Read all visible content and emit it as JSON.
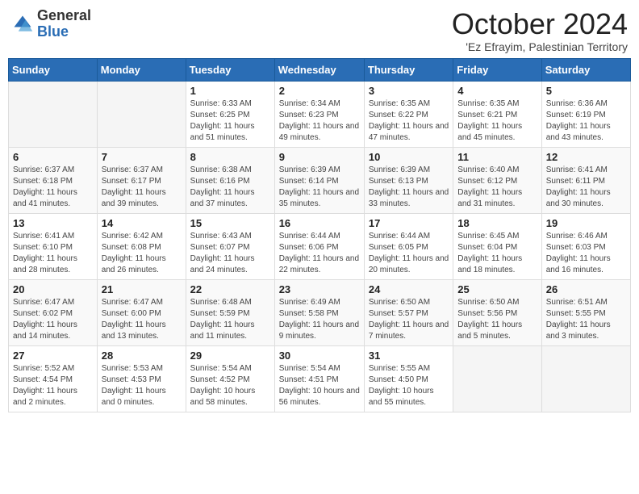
{
  "logo": {
    "general": "General",
    "blue": "Blue"
  },
  "title": "October 2024",
  "subtitle": "'Ez Efrayim, Palestinian Territory",
  "days_of_week": [
    "Sunday",
    "Monday",
    "Tuesday",
    "Wednesday",
    "Thursday",
    "Friday",
    "Saturday"
  ],
  "weeks": [
    [
      {
        "day": "",
        "info": ""
      },
      {
        "day": "",
        "info": ""
      },
      {
        "day": "1",
        "info": "Sunrise: 6:33 AM\nSunset: 6:25 PM\nDaylight: 11 hours and 51 minutes."
      },
      {
        "day": "2",
        "info": "Sunrise: 6:34 AM\nSunset: 6:23 PM\nDaylight: 11 hours and 49 minutes."
      },
      {
        "day": "3",
        "info": "Sunrise: 6:35 AM\nSunset: 6:22 PM\nDaylight: 11 hours and 47 minutes."
      },
      {
        "day": "4",
        "info": "Sunrise: 6:35 AM\nSunset: 6:21 PM\nDaylight: 11 hours and 45 minutes."
      },
      {
        "day": "5",
        "info": "Sunrise: 6:36 AM\nSunset: 6:19 PM\nDaylight: 11 hours and 43 minutes."
      }
    ],
    [
      {
        "day": "6",
        "info": "Sunrise: 6:37 AM\nSunset: 6:18 PM\nDaylight: 11 hours and 41 minutes."
      },
      {
        "day": "7",
        "info": "Sunrise: 6:37 AM\nSunset: 6:17 PM\nDaylight: 11 hours and 39 minutes."
      },
      {
        "day": "8",
        "info": "Sunrise: 6:38 AM\nSunset: 6:16 PM\nDaylight: 11 hours and 37 minutes."
      },
      {
        "day": "9",
        "info": "Sunrise: 6:39 AM\nSunset: 6:14 PM\nDaylight: 11 hours and 35 minutes."
      },
      {
        "day": "10",
        "info": "Sunrise: 6:39 AM\nSunset: 6:13 PM\nDaylight: 11 hours and 33 minutes."
      },
      {
        "day": "11",
        "info": "Sunrise: 6:40 AM\nSunset: 6:12 PM\nDaylight: 11 hours and 31 minutes."
      },
      {
        "day": "12",
        "info": "Sunrise: 6:41 AM\nSunset: 6:11 PM\nDaylight: 11 hours and 30 minutes."
      }
    ],
    [
      {
        "day": "13",
        "info": "Sunrise: 6:41 AM\nSunset: 6:10 PM\nDaylight: 11 hours and 28 minutes."
      },
      {
        "day": "14",
        "info": "Sunrise: 6:42 AM\nSunset: 6:08 PM\nDaylight: 11 hours and 26 minutes."
      },
      {
        "day": "15",
        "info": "Sunrise: 6:43 AM\nSunset: 6:07 PM\nDaylight: 11 hours and 24 minutes."
      },
      {
        "day": "16",
        "info": "Sunrise: 6:44 AM\nSunset: 6:06 PM\nDaylight: 11 hours and 22 minutes."
      },
      {
        "day": "17",
        "info": "Sunrise: 6:44 AM\nSunset: 6:05 PM\nDaylight: 11 hours and 20 minutes."
      },
      {
        "day": "18",
        "info": "Sunrise: 6:45 AM\nSunset: 6:04 PM\nDaylight: 11 hours and 18 minutes."
      },
      {
        "day": "19",
        "info": "Sunrise: 6:46 AM\nSunset: 6:03 PM\nDaylight: 11 hours and 16 minutes."
      }
    ],
    [
      {
        "day": "20",
        "info": "Sunrise: 6:47 AM\nSunset: 6:02 PM\nDaylight: 11 hours and 14 minutes."
      },
      {
        "day": "21",
        "info": "Sunrise: 6:47 AM\nSunset: 6:00 PM\nDaylight: 11 hours and 13 minutes."
      },
      {
        "day": "22",
        "info": "Sunrise: 6:48 AM\nSunset: 5:59 PM\nDaylight: 11 hours and 11 minutes."
      },
      {
        "day": "23",
        "info": "Sunrise: 6:49 AM\nSunset: 5:58 PM\nDaylight: 11 hours and 9 minutes."
      },
      {
        "day": "24",
        "info": "Sunrise: 6:50 AM\nSunset: 5:57 PM\nDaylight: 11 hours and 7 minutes."
      },
      {
        "day": "25",
        "info": "Sunrise: 6:50 AM\nSunset: 5:56 PM\nDaylight: 11 hours and 5 minutes."
      },
      {
        "day": "26",
        "info": "Sunrise: 6:51 AM\nSunset: 5:55 PM\nDaylight: 11 hours and 3 minutes."
      }
    ],
    [
      {
        "day": "27",
        "info": "Sunrise: 5:52 AM\nSunset: 4:54 PM\nDaylight: 11 hours and 2 minutes."
      },
      {
        "day": "28",
        "info": "Sunrise: 5:53 AM\nSunset: 4:53 PM\nDaylight: 11 hours and 0 minutes."
      },
      {
        "day": "29",
        "info": "Sunrise: 5:54 AM\nSunset: 4:52 PM\nDaylight: 10 hours and 58 minutes."
      },
      {
        "day": "30",
        "info": "Sunrise: 5:54 AM\nSunset: 4:51 PM\nDaylight: 10 hours and 56 minutes."
      },
      {
        "day": "31",
        "info": "Sunrise: 5:55 AM\nSunset: 4:50 PM\nDaylight: 10 hours and 55 minutes."
      },
      {
        "day": "",
        "info": ""
      },
      {
        "day": "",
        "info": ""
      }
    ]
  ]
}
